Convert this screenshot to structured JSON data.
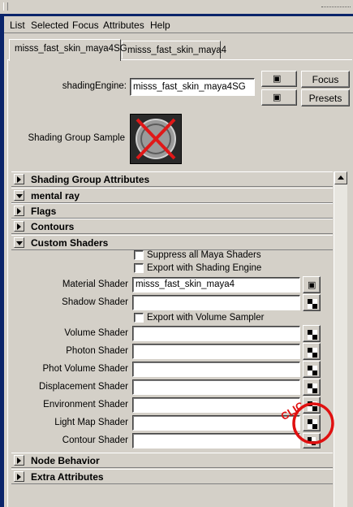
{
  "menu": [
    "List",
    "Selected",
    "Focus",
    "Attributes",
    "Help"
  ],
  "tabs": [
    {
      "label": "misss_fast_skin_maya4SG",
      "active": true
    },
    {
      "label": "misss_fast_skin_maya4",
      "active": false
    }
  ],
  "header": {
    "shading_engine_label": "shadingEngine:",
    "shading_engine_value": "misss_fast_skin_maya4SG",
    "focus_label": "Focus",
    "presets_label": "Presets",
    "sample_label": "Shading Group Sample"
  },
  "sections": {
    "shading_group": "Shading Group Attributes",
    "mental_ray": "mental ray",
    "flags": "Flags",
    "contours": "Contours",
    "custom_shaders": "Custom Shaders",
    "node_behavior": "Node Behavior",
    "extra_attributes": "Extra Attributes"
  },
  "custom_shaders": {
    "suppress_label": "Suppress all Maya Shaders",
    "export_engine_label": "Export with Shading Engine",
    "export_volume_label": "Export with Volume Sampler",
    "fields": [
      {
        "label": "Material Shader",
        "value": "misss_fast_skin_maya4"
      },
      {
        "label": "Shadow Shader",
        "value": ""
      },
      {
        "label": "Volume Shader",
        "value": ""
      },
      {
        "label": "Photon Shader",
        "value": ""
      },
      {
        "label": "Phot Volume Shader",
        "value": ""
      },
      {
        "label": "Displacement Shader",
        "value": ""
      },
      {
        "label": "Environment Shader",
        "value": ""
      },
      {
        "label": "Light Map Shader",
        "value": ""
      },
      {
        "label": "Contour Shader",
        "value": ""
      }
    ]
  },
  "annotation": {
    "text": "CLIC",
    "color": "#e01010"
  }
}
